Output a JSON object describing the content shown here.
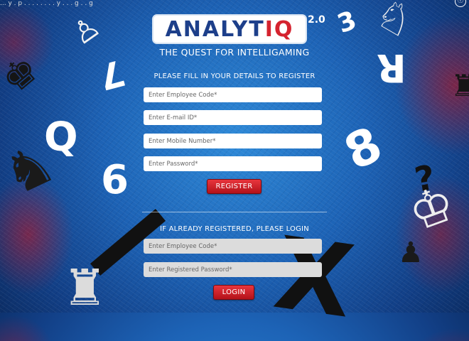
{
  "header": {
    "partial_title": "... y . p . . . . . . . . y . . . g . . g",
    "info_glyph": "ⓘ"
  },
  "logo": {
    "text_main": "ANALYT",
    "text_accent": "IQ",
    "version": "2.0"
  },
  "tagline": "THE QUEST FOR INTELLIGAMING",
  "register": {
    "title": "PLEASE FILL IN YOUR DETAILS TO REGISTER",
    "employee_code_placeholder": "Enter Employee Code*",
    "email_placeholder": "Enter E-mail ID*",
    "mobile_placeholder": "Enter Mobile Number*",
    "password_placeholder": "Enter Password*",
    "button_label": "REGISTER"
  },
  "login": {
    "title": "IF ALREADY REGISTERED, PLEASE LOGIN",
    "employee_code_placeholder": "Enter Employee Code*",
    "password_placeholder": "Enter Registered Password*",
    "button_label": "LOGIN"
  },
  "decorations": {
    "glyphs": [
      "7",
      "3",
      "R",
      "Q",
      "6",
      "8",
      "?",
      "X"
    ],
    "pieces": [
      "♙",
      "♚",
      "♞",
      "♜",
      "♔",
      "♟"
    ]
  },
  "colors": {
    "accent": "#d5232f",
    "brand": "#1d3f8a",
    "background": "#1d63b6"
  }
}
